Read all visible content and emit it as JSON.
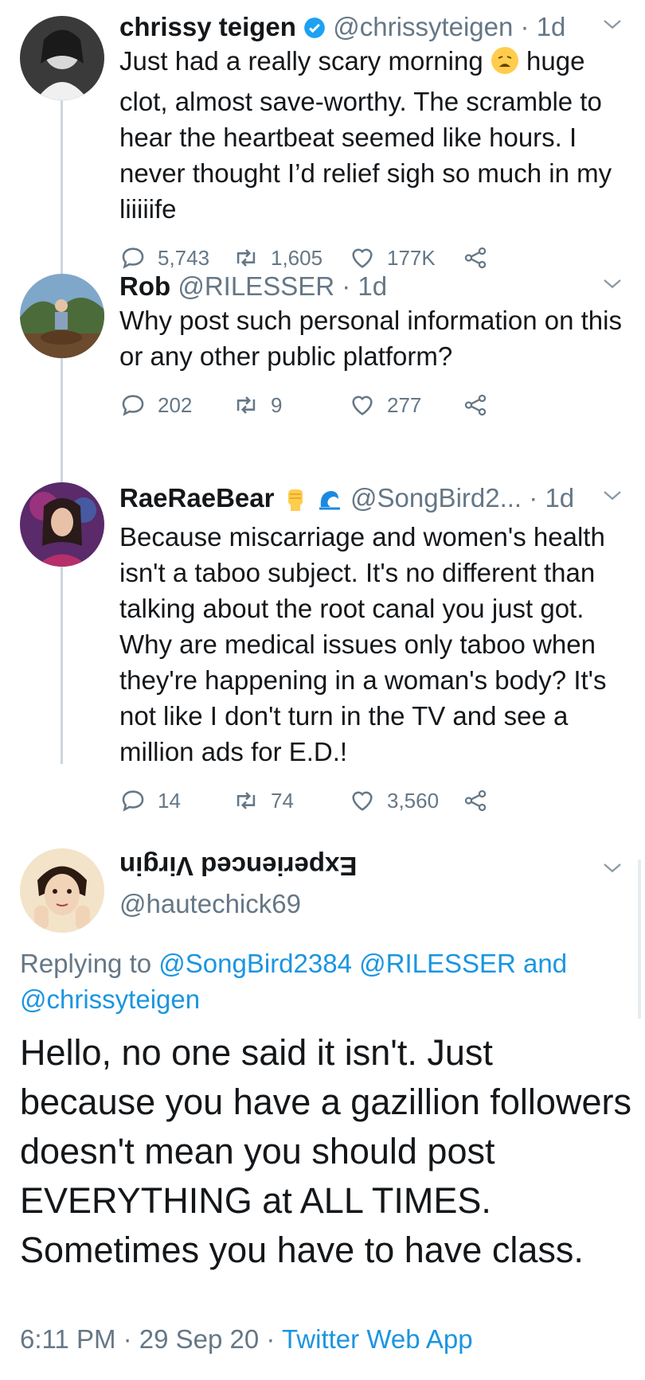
{
  "thread": [
    {
      "name": "chrissy teigen",
      "handle": "@chrissyteigen",
      "time": "· 1d",
      "verified": true,
      "text_before_emoji": "Just had a really scary morning ",
      "emoji": "weary-face-emoji",
      "text_after_emoji": " huge clot, almost save-worthy. The scramble to hear the heartbeat seemed like hours. I never thought I’d relief sigh so much in my liiiiife",
      "replies": "5,743",
      "retweets": "1,605",
      "likes": "177K"
    },
    {
      "name": "Rob",
      "handle": "@RILESSER",
      "time": "· 1d",
      "text": "Why post such personal information on this or any other public platform?",
      "replies": "202",
      "retweets": "9",
      "likes": "277"
    },
    {
      "name": "RaeRaeBear",
      "handle": "@SongBird2...",
      "time": "· 1d",
      "badges": [
        "raised-fist-emoji",
        "wave-emoji"
      ],
      "text": "Because miscarriage and women's health isn't a taboo subject. It's no different than talking about the root canal you just got. Why are medical issues only taboo when they're happening in a woman's body? It's not like I don't turn in the TV and see a million ads for E.D.!",
      "replies": "14",
      "retweets": "74",
      "likes": "3,560"
    }
  ],
  "main": {
    "name": "Experienced Virgin",
    "handle": "@hautechick69",
    "replying_prefix": "Replying to",
    "mention1": "@SongBird2384",
    "mention2": "@RILESSER",
    "and": "and",
    "mention3": "@chrissyteigen",
    "text": "Hello, no one said it isn't. Just because you have a gazillion followers doesn't mean you should post EVERYTHING at ALL TIMES. Sometimes you have to have class.",
    "time": "6:11 PM · 29 Sep 20 · ",
    "source": "Twitter Web App"
  },
  "colors": {
    "link": "#1b95e0",
    "muted": "#657786",
    "verified": "#1da1f2"
  }
}
